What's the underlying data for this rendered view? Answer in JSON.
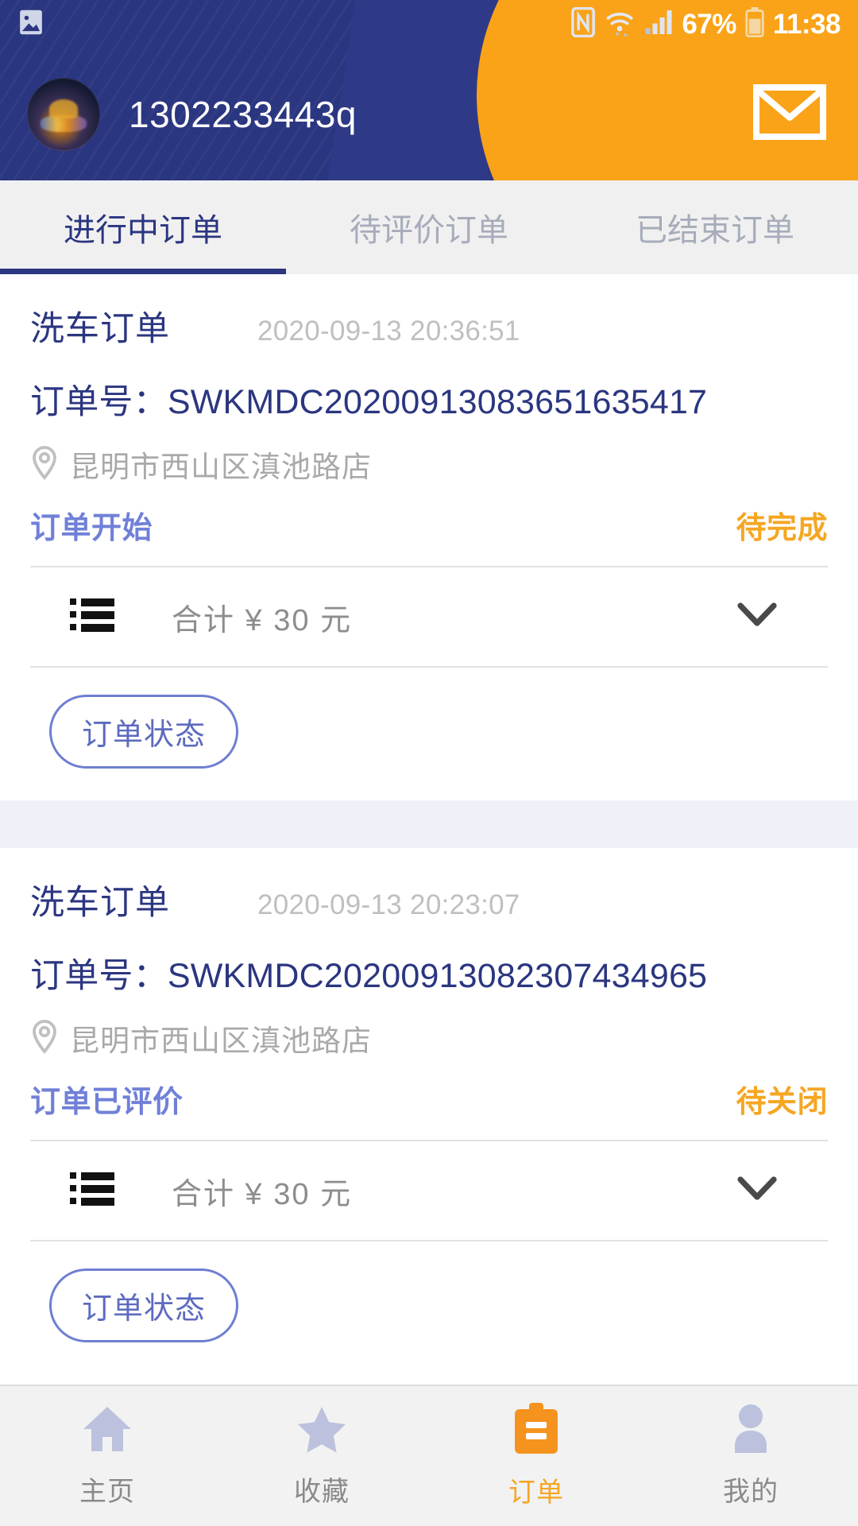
{
  "status_bar": {
    "photo_icon": "image-icon",
    "nfc_icon": "nfc-icon",
    "wifi_icon": "wifi-icon",
    "signal_icon": "signal-icon",
    "battery_percent": "67%",
    "battery_icon": "battery-icon",
    "time": "11:38"
  },
  "header": {
    "avatar_icon": "avatar",
    "username": "1302233443q",
    "mail_icon": "mail-icon",
    "bg_color": "#2b3680",
    "accent_color": "#faa318"
  },
  "tabs": [
    {
      "label": "进行中订单",
      "active": true
    },
    {
      "label": "待评价订单",
      "active": false
    },
    {
      "label": "已结束订单",
      "active": false
    }
  ],
  "orders": [
    {
      "title": "洗车订单",
      "time": "2020-09-13 20:36:51",
      "order_no_label": "订单号：",
      "order_no": "SWKMDC20200913083651635417",
      "location_icon": "location-pin-icon",
      "location": "昆明市西山区滇池路店",
      "progress_label": "订单开始",
      "state_label": "待完成",
      "list_icon": "list-icon",
      "total_text": "合计 ¥ 30 元",
      "expand_icon": "chevron-down-icon",
      "action_button": "订单状态"
    },
    {
      "title": "洗车订单",
      "time": "2020-09-13 20:23:07",
      "order_no_label": "订单号：",
      "order_no": "SWKMDC20200913082307434965",
      "location_icon": "location-pin-icon",
      "location": "昆明市西山区滇池路店",
      "progress_label": "订单已评价",
      "state_label": "待关闭",
      "list_icon": "list-icon",
      "total_text": "合计 ¥ 30 元",
      "expand_icon": "chevron-down-icon",
      "action_button": "订单状态"
    }
  ],
  "bottom_nav": [
    {
      "label": "主页",
      "icon": "home-icon",
      "active": false
    },
    {
      "label": "收藏",
      "icon": "star-icon",
      "active": false
    },
    {
      "label": "订单",
      "icon": "clipboard-icon",
      "active": true
    },
    {
      "label": "我的",
      "icon": "person-icon",
      "active": false
    }
  ],
  "colors": {
    "brand_navy": "#2b3680",
    "brand_orange": "#f5a623",
    "muted": "#a9a9a9",
    "periwinkle": "#7080d8"
  }
}
